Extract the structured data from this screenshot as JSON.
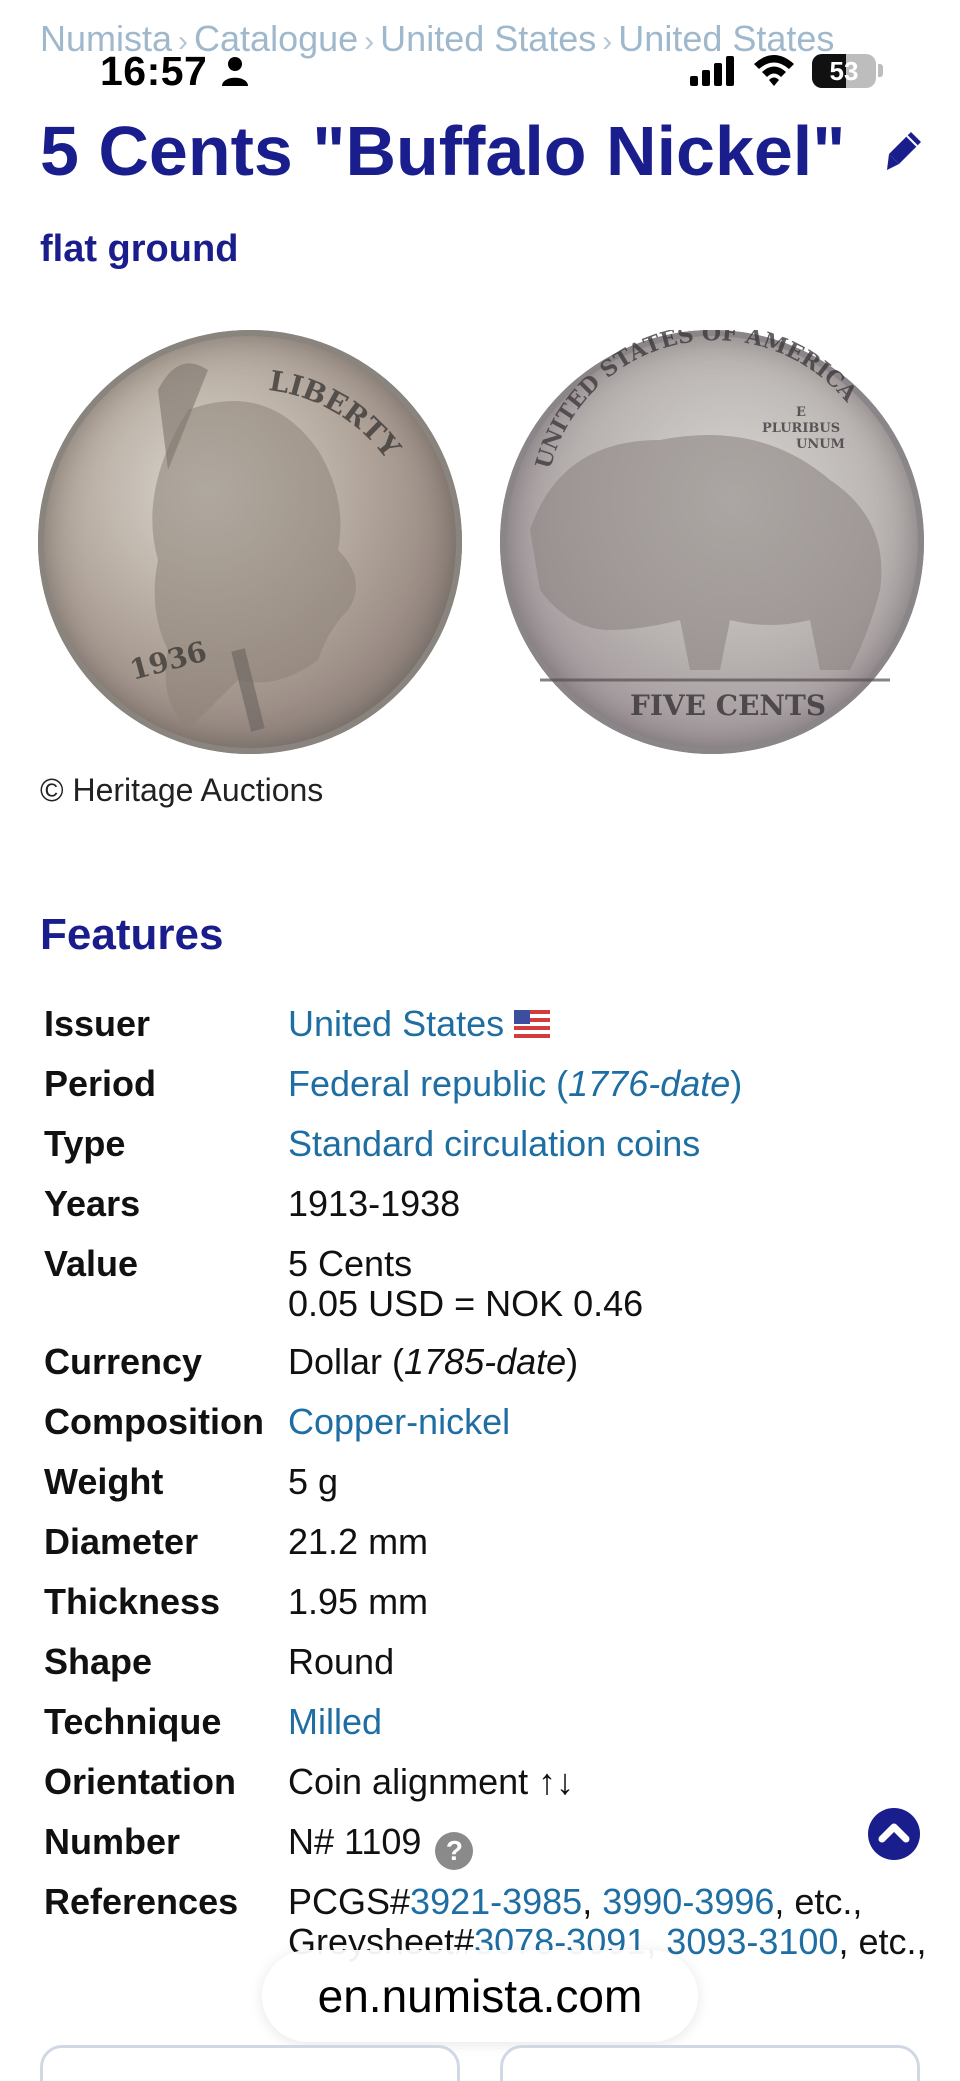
{
  "breadcrumb": {
    "items": [
      "Numista",
      "Catalogue",
      "United States",
      "United States"
    ],
    "separator": "›"
  },
  "status_bar": {
    "time": "16:57",
    "battery_level": "53",
    "battery_fraction": 0.53,
    "icons": [
      "person-icon",
      "signal-icon",
      "wifi-icon",
      "battery-icon"
    ]
  },
  "title": {
    "main": "5 Cents \"Buffalo Nickel\"",
    "subtitle": "flat ground",
    "edit_icon": "pencil-icon"
  },
  "images": {
    "obverse": {
      "legend": "LIBERTY",
      "date": "1936"
    },
    "reverse": {
      "legend": "UNITED STATES OF AMERICA",
      "motto_1": "E",
      "motto_2": "PLURIBUS",
      "motto_3": "UNUM",
      "denomination": "FIVE CENTS"
    },
    "copyright": "© Heritage Auctions"
  },
  "features": {
    "heading": "Features",
    "rows": {
      "issuer": {
        "label": "Issuer",
        "value": "United States",
        "flag": "us-flag-icon"
      },
      "period": {
        "label": "Period",
        "value": "Federal republic (",
        "range": "1776-date",
        "close": ")"
      },
      "type": {
        "label": "Type",
        "value": "Standard circulation coins"
      },
      "years": {
        "label": "Years",
        "value": "1913-1938"
      },
      "value": {
        "label": "Value",
        "line1": "5 Cents",
        "line2": "0.05 USD = NOK 0.46"
      },
      "currency": {
        "label": "Currency",
        "value": "Dollar (",
        "range": "1785-date",
        "close": ")"
      },
      "composition": {
        "label": "Composition",
        "value": "Copper-nickel"
      },
      "weight": {
        "label": "Weight",
        "value": "5 g"
      },
      "diameter": {
        "label": "Diameter",
        "value": "21.2 mm"
      },
      "thickness": {
        "label": "Thickness",
        "value": "1.95 mm"
      },
      "shape": {
        "label": "Shape",
        "value": "Round"
      },
      "technique": {
        "label": "Technique",
        "value": "Milled"
      },
      "orientation": {
        "label": "Orientation",
        "value": "Coin alignment ↑↓"
      },
      "number": {
        "label": "Number",
        "value": "N# 1109",
        "help": "?"
      },
      "references": {
        "label": "References",
        "line1_prefix": "PCGS#",
        "line1_link1": "3921-3985",
        "line1_sep": ", ",
        "line1_link2": "3990-3996",
        "line1_suffix": ", etc.,",
        "line2_prefix": "Greysheet#",
        "line2_link1": "3078-3091",
        "line2_sep": ", ",
        "line2_link2": "3093-3100",
        "line2_suffix": ", etc.,"
      }
    }
  },
  "browser": {
    "url": "en.numista.com"
  },
  "colors": {
    "title": "#1a1e8c",
    "link": "#1e6ea3",
    "breadcrumb": "#9fb8cc"
  }
}
